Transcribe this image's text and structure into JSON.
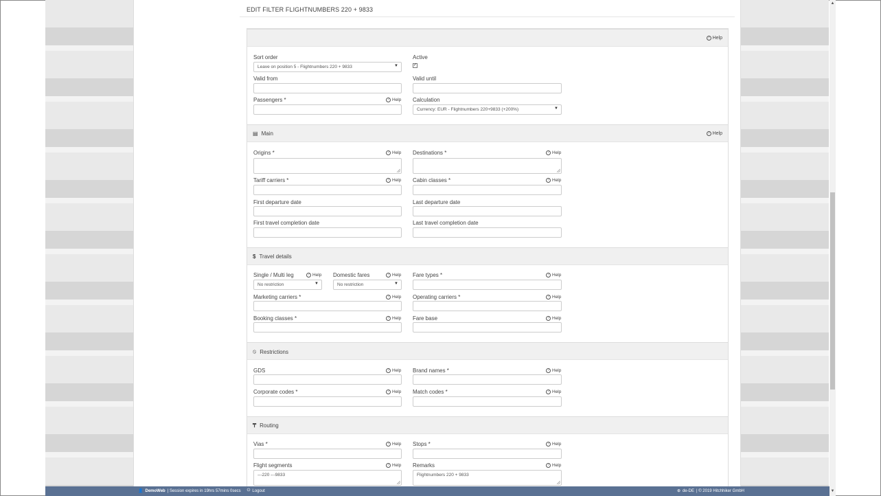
{
  "page_title": "EDIT FILTER FLIGHTNUMBERS 220 + 9833",
  "help_label": "Help",
  "top": {
    "sort_order_label": "Sort order",
    "sort_order_value": "Leave on position 5 - Flightnumbers 220 + 9833",
    "active_label": "Active",
    "active_checked": true,
    "valid_from_label": "Valid from",
    "valid_until_label": "Valid until",
    "passengers_label": "Passengers *",
    "calculation_label": "Calculation",
    "calculation_value": "Currency: EUR - Flightnumbers 220+9833 (+200%)"
  },
  "sections": {
    "main": "Main",
    "travel": "Travel details",
    "restrictions": "Restrictions",
    "routing": "Routing"
  },
  "main": {
    "origins": "Origins *",
    "destinations": "Destinations *",
    "tariff_carriers": "Tariff carriers *",
    "cabin_classes": "Cabin classes *",
    "first_departure": "First departure date",
    "last_departure": "Last departure date",
    "first_completion": "First travel completion date",
    "last_completion": "Last travel completion date"
  },
  "travel": {
    "single_multi": "Single / Multi leg",
    "single_multi_value": "No restriction",
    "domestic": "Domestic fares",
    "domestic_value": "No restriction",
    "fare_types": "Fare types *",
    "marketing": "Marketing carriers *",
    "operating": "Operating carriers *",
    "booking": "Booking classes *",
    "fare_base": "Fare base"
  },
  "restrictions": {
    "gds": "GDS",
    "brand_names": "Brand names *",
    "corporate": "Corporate codes *",
    "match_codes": "Match codes *"
  },
  "routing": {
    "vias": "Vias *",
    "stops": "Stops *",
    "flight_segments": "Flight segments",
    "flight_segments_value": "---220 ---9833",
    "remarks": "Remarks",
    "remarks_value": "Flightnumbers 220 + 9833"
  },
  "footer": {
    "user": "DemoWeb",
    "session": "| Session expires in 19hrs 57mins 0secs",
    "logout": "Logout",
    "locale": "de-DE",
    "copyright": "| © 2019 Hitchhiker GmbH"
  },
  "icons": {
    "main": "list-icon",
    "travel": "dollar-icon",
    "restrictions": "ban-icon",
    "routing": "signpost-icon"
  }
}
